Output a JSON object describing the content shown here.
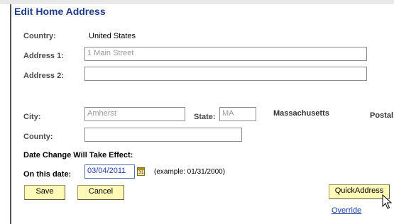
{
  "form": {
    "title": "Edit Home Address",
    "country_label": "Country:",
    "country_value": "United States",
    "address1_label": "Address 1:",
    "address1_value": "1 Main Street",
    "address2_label": "Address 2:",
    "address2_value": "",
    "city_label": "City:",
    "city_value": "Amherst",
    "state_label": "State:",
    "state_value": "MA",
    "state_name": "Massachusetts",
    "postal_label": "Postal",
    "county_label": "County:",
    "county_value": "",
    "effective_heading": "Date Change Will Take Effect:",
    "date_label": "On this date:",
    "date_value": "03/04/2011",
    "date_example": "(example: 01/31/2000)",
    "calendar_icon_text": "31"
  },
  "actions": {
    "quickaddress_label": "QuickAddress",
    "save_label": "Save",
    "cancel_label": "Cancel",
    "override_label": "Override"
  },
  "colors": {
    "title": "#1f3c87",
    "button_bg": "#fff9b8",
    "link": "#1f3fa6"
  },
  "icons": [
    "calendar-icon",
    "mouse-pointer-icon"
  ]
}
